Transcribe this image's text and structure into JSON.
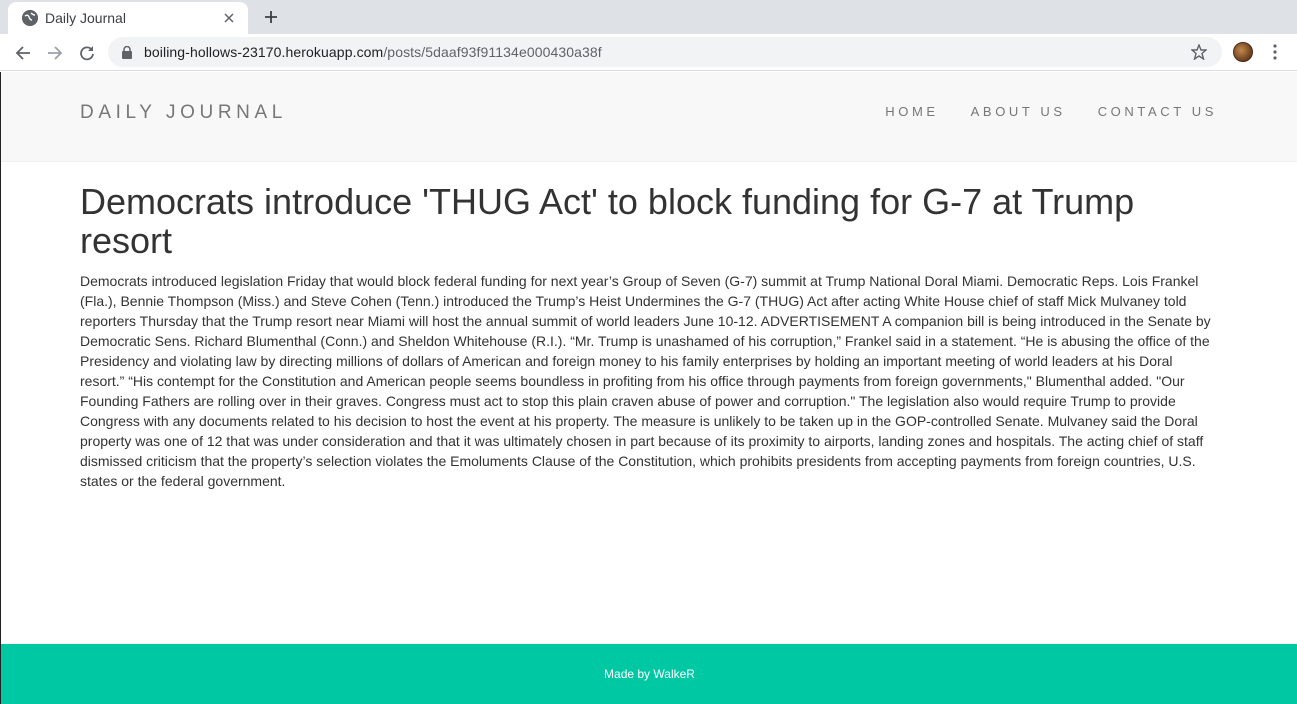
{
  "browser": {
    "tab_title": "Daily Journal",
    "url_host": "boiling-hollows-23170.herokuapp.com",
    "url_path": "/posts/5daaf93f91134e000430a38f"
  },
  "site": {
    "brand": "DAILY JOURNAL",
    "nav": [
      "HOME",
      "ABOUT US",
      "CONTACT US"
    ]
  },
  "post": {
    "title": "Democrats introduce 'THUG Act' to block funding for G-7 at Trump resort",
    "body": "Democrats introduced legislation Friday that would block federal funding for next year’s Group of Seven (G-7) summit at Trump National Doral Miami. Democratic Reps. Lois Frankel (Fla.), Bennie Thompson (Miss.) and Steve Cohen (Tenn.) introduced the Trump’s Heist Undermines the G-7 (THUG) Act after acting White House chief of staff Mick Mulvaney told reporters Thursday that the Trump resort near Miami will host the annual summit of world leaders June 10-12. ADVERTISEMENT A companion bill is being introduced in the Senate by Democratic Sens. Richard Blumenthal (Conn.) and Sheldon Whitehouse (R.I.). “Mr. Trump is unashamed of his corruption,” Frankel said in a statement. “He is abusing the office of the Presidency and violating law by directing millions of dollars of American and foreign money to his family enterprises by holding an important meeting of world leaders at his Doral resort.” “His contempt for the Constitution and American people seems boundless in profiting from his office through payments from foreign governments,\" Blumenthal added. \"Our Founding Fathers are rolling over in their graves. Congress must act to stop this plain craven abuse of power and corruption.\" The legislation also would require Trump to provide Congress with any documents related to his decision to host the event at his property. The measure is unlikely to be taken up in the GOP-controlled Senate. Mulvaney said the Doral property was one of 12 that was under consideration and that it was ultimately chosen in part because of its proximity to airports, landing zones and hospitals. The acting chief of staff dismissed criticism that the property’s selection violates the Emoluments Clause of the Constitution, which prohibits presidents from accepting payments from foreign countries, U.S. states or the federal government."
  },
  "footer": {
    "text": "Made by WalkeR"
  },
  "colors": {
    "footer_bg": "#00c8a3",
    "header_bg": "#f8f8f8",
    "text": "#333333"
  },
  "icons": [
    "globe-icon",
    "close-icon",
    "plus-icon",
    "back-arrow-icon",
    "forward-arrow-icon",
    "reload-icon",
    "lock-icon",
    "star-icon",
    "kebab-menu-icon"
  ]
}
